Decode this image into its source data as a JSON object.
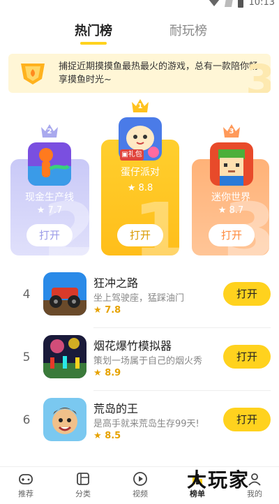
{
  "status_bar": {
    "time": "10:13"
  },
  "tabs": [
    {
      "label": "热门榜",
      "active": true
    },
    {
      "label": "耐玩榜",
      "active": false
    }
  ],
  "banner": {
    "text": "捕捉近期摸摸鱼最热最火的游戏，总有一款陪你畅享摸鱼时光~"
  },
  "podium": [
    {
      "rank": "1",
      "name": "蛋仔派对",
      "rating": "8.8",
      "button": "打开",
      "badge": "礼包"
    },
    {
      "rank": "2",
      "name": "现金生产线",
      "rating": "7.7",
      "button": "打开"
    },
    {
      "rank": "3",
      "name": "迷你世界",
      "rating": "8.7",
      "button": "打开"
    }
  ],
  "list": [
    {
      "rank": "4",
      "name": "狂冲之路",
      "desc": "坐上驾驶座，猛踩油门",
      "rating": "7.8",
      "button": "打开"
    },
    {
      "rank": "5",
      "name": "烟花爆竹模拟器",
      "desc": "策划一场属于自己的烟火秀",
      "rating": "8.9",
      "button": "打开"
    },
    {
      "rank": "6",
      "name": "荒岛的王",
      "desc": "是高手就来荒岛生存99天!",
      "rating": "8.5",
      "button": "打开"
    }
  ],
  "bottom_nav": [
    {
      "label": "推荐",
      "icon": "gamepad-icon"
    },
    {
      "label": "分类",
      "icon": "category-icon"
    },
    {
      "label": "视频",
      "icon": "play-icon"
    },
    {
      "label": "榜单",
      "icon": "rank-icon"
    },
    {
      "label": "我的",
      "icon": "profile-icon"
    }
  ],
  "watermark": "大玩家",
  "colors": {
    "accent": "#ffd21e",
    "rank1": "#ffc21e",
    "rank2": "#c9c9f7",
    "rank3": "#ffb278"
  }
}
